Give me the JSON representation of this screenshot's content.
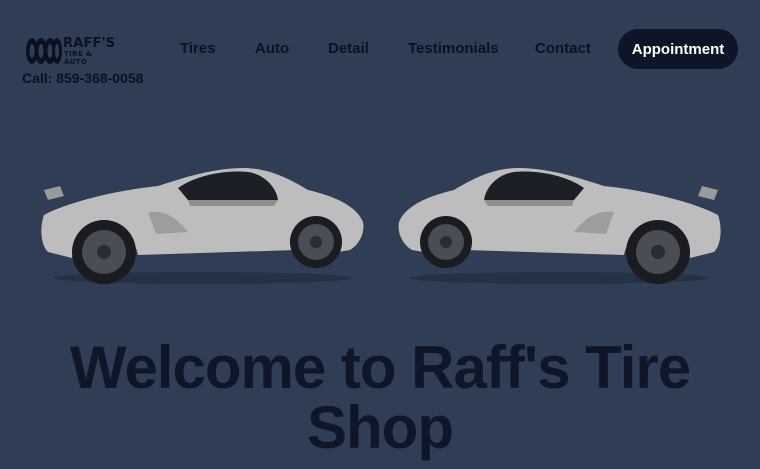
{
  "brand": {
    "name": "RAFF'S",
    "tagline": "TIRE & AUTO",
    "phone": "Call: 859-368-0058"
  },
  "nav": {
    "links": [
      {
        "label": "Tires"
      },
      {
        "label": "Auto"
      },
      {
        "label": "Detail"
      },
      {
        "label": "Testimonials"
      },
      {
        "label": "Contact"
      }
    ],
    "cta_label": "Appointment"
  },
  "hero": {
    "title": "Welcome to Raff's Tire Shop"
  },
  "colors": {
    "background": "#2f3e55",
    "text_dark": "#0e1628",
    "button_bg": "#0d1526",
    "button_text": "#ffffff",
    "car_body": "#bdbdbd"
  },
  "icons": {
    "logo": "tire-stack-icon",
    "hero_left": "sports-car-image",
    "hero_right": "sports-car-image-mirrored"
  }
}
